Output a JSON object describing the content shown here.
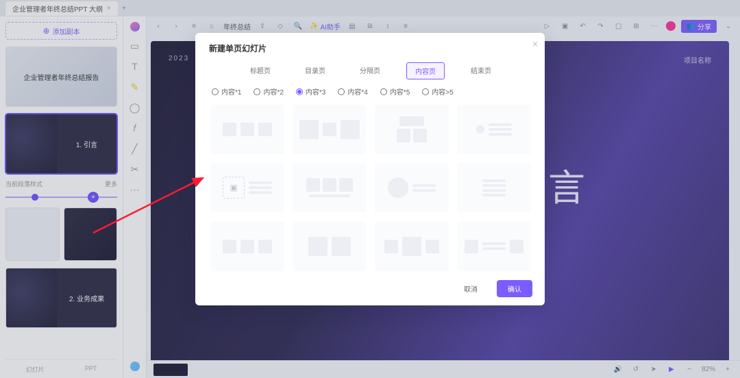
{
  "tabstrip": {
    "doc_title": "企业管理者年终总结PPT 大纲",
    "close": "×",
    "plus": "+"
  },
  "left": {
    "add_slide": "添加副本",
    "thumb1_caption": "企业管理者年终总结报告",
    "thumb2_caption": "1. 引言",
    "section_left": "当前段落样式",
    "section_right": "更多",
    "thumb3_caption": "2. 业务成果",
    "footer_left": "幻灯片",
    "footer_right": "PPT"
  },
  "toolbar": {
    "doc_label": "年终总结",
    "ai_label": "AI助手",
    "share": "分享"
  },
  "canvas": {
    "year": "2023",
    "project_label": "项目名称",
    "big_char": "言"
  },
  "bottom": {
    "zoom": "82%"
  },
  "modal": {
    "title": "新建单页幻灯片",
    "tabs": [
      "标题页",
      "目录页",
      "分隔页",
      "内容页",
      "结束页"
    ],
    "active_tab_index": 3,
    "radios": [
      "内容*1",
      "内容*2",
      "内容*3",
      "内容*4",
      "内容*5",
      "内容>5"
    ],
    "radio_selected_index": 2,
    "cancel": "取消",
    "ok": "确认"
  }
}
